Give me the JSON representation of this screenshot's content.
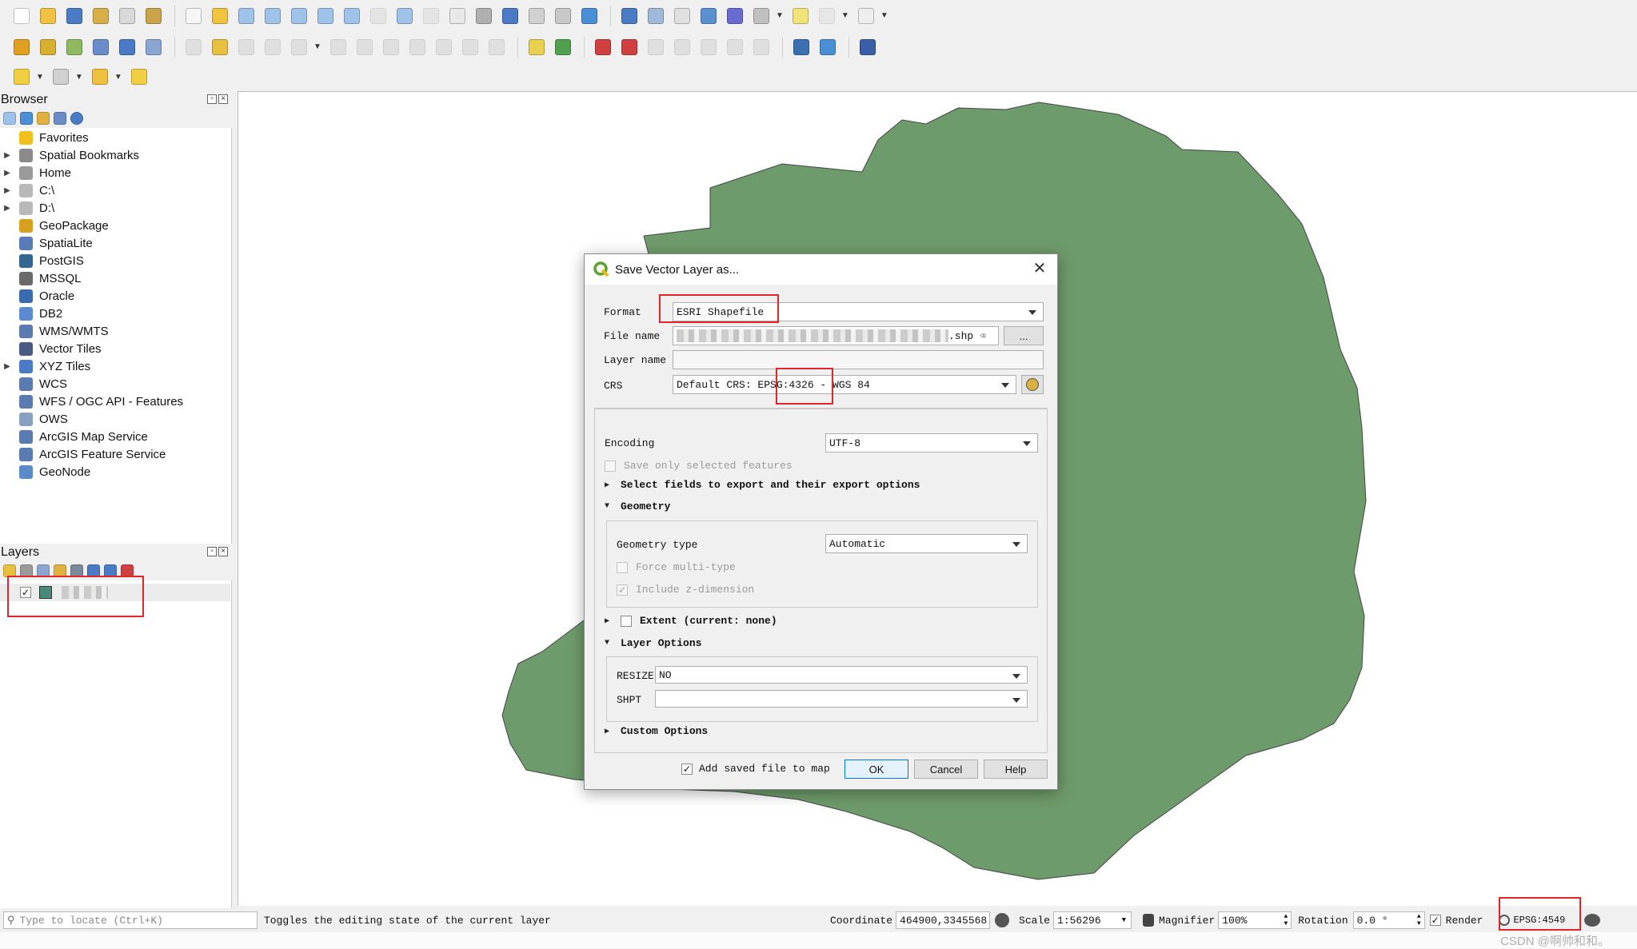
{
  "toolbars": {
    "row1": [
      {
        "name": "new-project-icon",
        "color": "#ffffff"
      },
      {
        "name": "open-project-icon",
        "color": "#f2c244"
      },
      {
        "name": "save-project-icon",
        "color": "#4a7bc4"
      },
      {
        "name": "save-as-icon",
        "color": "#d8b04a"
      },
      {
        "name": "print-layout-icon",
        "color": "#d9d9d9"
      },
      {
        "name": "style-manager-icon",
        "color": "#c9a44a"
      },
      {
        "sep": true
      },
      {
        "name": "pan-map-icon",
        "color": "#f6f6f6"
      },
      {
        "name": "pan-to-selection-icon",
        "color": "#f0c440"
      },
      {
        "name": "zoom-in-icon",
        "color": "#9fc2e8"
      },
      {
        "name": "zoom-out-icon",
        "color": "#9fc2e8"
      },
      {
        "name": "zoom-full-icon",
        "color": "#9fc2e8"
      },
      {
        "name": "zoom-to-selection-icon",
        "color": "#9fc2e8"
      },
      {
        "name": "zoom-to-layer-icon",
        "color": "#9fc2e8"
      },
      {
        "name": "zoom-native-icon",
        "color": "#d0d0d0",
        "dim": true
      },
      {
        "name": "zoom-last-icon",
        "color": "#9fc2e8"
      },
      {
        "name": "zoom-next-icon",
        "color": "#d0d0d0",
        "dim": true
      },
      {
        "name": "new-map-view-icon",
        "color": "#e8e8e8"
      },
      {
        "name": "new-3d-map-icon",
        "color": "#b0b0b0"
      },
      {
        "name": "new-bookmark-icon",
        "color": "#4a7bc4"
      },
      {
        "name": "show-bookmarks-icon",
        "color": "#d0d0d0"
      },
      {
        "name": "temporal-controller-icon",
        "color": "#c8c8c8"
      },
      {
        "name": "refresh-icon",
        "color": "#4a8fd6"
      },
      {
        "sep": true
      },
      {
        "name": "identify-icon",
        "color": "#4a7bc4"
      },
      {
        "name": "attribute-table-icon",
        "color": "#9fb9d9"
      },
      {
        "name": "field-calculator-icon",
        "color": "#e0e0e0"
      },
      {
        "name": "settings-icon",
        "color": "#5a8fd0"
      },
      {
        "name": "statistics-icon",
        "color": "#6a6ad0"
      },
      {
        "name": "measure-icon",
        "color": "#c0c0c0",
        "drop": true
      },
      {
        "name": "map-tips-icon",
        "color": "#f2e27a"
      },
      {
        "name": "selection-options-icon",
        "color": "#d8d8d8",
        "dim": true,
        "drop": true
      },
      {
        "name": "text-annotation-icon",
        "color": "#eeeeee",
        "drop": true
      }
    ],
    "row2": [
      {
        "name": "data-source-manager-icon",
        "color": "#e0a020"
      },
      {
        "name": "new-geopackage-icon",
        "color": "#d8b030"
      },
      {
        "name": "new-shapefile-icon",
        "color": "#90b860"
      },
      {
        "name": "new-spatialite-icon",
        "color": "#6a8cc8"
      },
      {
        "name": "new-temporary-layer-icon",
        "color": "#4a7bc4"
      },
      {
        "name": "new-virtual-layer-icon",
        "color": "#8aa6d0"
      },
      {
        "sep": true
      },
      {
        "name": "current-edits-icon",
        "color": "#c0c0c0",
        "dim": true
      },
      {
        "name": "toggle-editing-icon",
        "color": "#e8c040"
      },
      {
        "name": "save-edits-icon",
        "color": "#c0c0c0",
        "dim": true
      },
      {
        "name": "add-feature-icon",
        "color": "#c0c0c0",
        "dim": true
      },
      {
        "name": "vertex-tool-icon",
        "color": "#c0c0c0",
        "dim": true,
        "drop": true
      },
      {
        "name": "modify-attributes-icon",
        "color": "#c0c0c0",
        "dim": true
      },
      {
        "name": "delete-selected-icon",
        "color": "#c0c0c0",
        "dim": true
      },
      {
        "name": "cut-features-icon",
        "color": "#c0c0c0",
        "dim": true
      },
      {
        "name": "copy-features-icon",
        "color": "#c0c0c0",
        "dim": true
      },
      {
        "name": "paste-features-icon",
        "color": "#c0c0c0",
        "dim": true
      },
      {
        "name": "undo-icon",
        "color": "#c0c0c0",
        "dim": true
      },
      {
        "name": "redo-icon",
        "color": "#c0c0c0",
        "dim": true
      },
      {
        "sep": true
      },
      {
        "name": "label-icon",
        "color": "#e8d050"
      },
      {
        "name": "layer-labeling-icon",
        "color": "#50a050"
      },
      {
        "sep": true
      },
      {
        "name": "pin-labels-icon",
        "color": "#d04040"
      },
      {
        "name": "highlight-pinned-icon",
        "color": "#d04040"
      },
      {
        "name": "move-label-icon",
        "color": "#c0c0c0",
        "dim": true
      },
      {
        "name": "rotate-label-icon",
        "color": "#c0c0c0",
        "dim": true
      },
      {
        "name": "change-label-icon",
        "color": "#c0c0c0",
        "dim": true
      },
      {
        "name": "show-hide-labels-icon",
        "color": "#c0c0c0",
        "dim": true
      },
      {
        "name": "label-props-icon",
        "color": "#c0c0c0",
        "dim": true
      },
      {
        "sep": true
      },
      {
        "name": "python-console-icon",
        "color": "#3a70b0"
      },
      {
        "name": "processing-icon",
        "color": "#4a8fd6"
      },
      {
        "sep": true
      },
      {
        "name": "help-icon",
        "color": "#3a5fa8"
      }
    ],
    "row3": [
      {
        "name": "select-features-icon",
        "color": "#f0d040",
        "drop": true
      },
      {
        "name": "select-by-expression-icon",
        "color": "#d0d0d0",
        "drop": true
      },
      {
        "name": "deselect-all-icon",
        "color": "#f0c040",
        "drop": true
      },
      {
        "name": "select-by-location-icon",
        "color": "#f0d040"
      }
    ]
  },
  "browser": {
    "title": "Browser",
    "items": [
      {
        "label": "Favorites",
        "icon": "star-icon",
        "color": "#f0c020",
        "arrow": ""
      },
      {
        "label": "Spatial Bookmarks",
        "icon": "bookmark-icon",
        "color": "#8a8a8a",
        "arrow": "▶"
      },
      {
        "label": "Home",
        "icon": "home-icon",
        "color": "#9a9a9a",
        "arrow": "▶"
      },
      {
        "label": "C:\\",
        "icon": "drive-icon",
        "color": "#b8b8b8",
        "arrow": "▶"
      },
      {
        "label": "D:\\",
        "icon": "drive-icon",
        "color": "#b8b8b8",
        "arrow": "▶"
      },
      {
        "label": "GeoPackage",
        "icon": "geopackage-icon",
        "color": "#d8a020",
        "arrow": ""
      },
      {
        "label": "SpatiaLite",
        "icon": "spatialite-icon",
        "color": "#5a7ab8",
        "arrow": ""
      },
      {
        "label": "PostGIS",
        "icon": "postgis-icon",
        "color": "#336791",
        "arrow": ""
      },
      {
        "label": "MSSQL",
        "icon": "mssql-icon",
        "color": "#6a6a6a",
        "arrow": ""
      },
      {
        "label": "Oracle",
        "icon": "oracle-icon",
        "color": "#3a6ab0",
        "arrow": ""
      },
      {
        "label": "DB2",
        "icon": "db2-icon",
        "color": "#5a8ad0",
        "arrow": ""
      },
      {
        "label": "WMS/WMTS",
        "icon": "wms-icon",
        "color": "#5a7ab0",
        "arrow": ""
      },
      {
        "label": "Vector Tiles",
        "icon": "vector-tiles-icon",
        "color": "#4a5a80",
        "arrow": ""
      },
      {
        "label": "XYZ Tiles",
        "icon": "xyz-tiles-icon",
        "color": "#4a7bc4",
        "arrow": "▶"
      },
      {
        "label": "WCS",
        "icon": "wcs-icon",
        "color": "#5a7ab0",
        "arrow": ""
      },
      {
        "label": "WFS / OGC API - Features",
        "icon": "wfs-icon",
        "color": "#5a7ab0",
        "arrow": ""
      },
      {
        "label": "OWS",
        "icon": "ows-icon",
        "color": "#8aa0c0",
        "arrow": ""
      },
      {
        "label": "ArcGIS Map Service",
        "icon": "arcgis-map-icon",
        "color": "#5a7ab0",
        "arrow": ""
      },
      {
        "label": "ArcGIS Feature Service",
        "icon": "arcgis-feature-icon",
        "color": "#5a7ab0",
        "arrow": ""
      },
      {
        "label": "GeoNode",
        "icon": "geonode-icon",
        "color": "#5a8ac8",
        "arrow": ""
      }
    ]
  },
  "layers": {
    "title": "Layers",
    "swatch_color": "#4a8a7a",
    "checked": "✓"
  },
  "map": {
    "polygon_fill": "#6e9b6b",
    "polygon_stroke": "#444444"
  },
  "dialog": {
    "title": "Save Vector Layer as...",
    "close": "✕",
    "format_label": "Format",
    "format_value": "ESRI Shapefile",
    "filename_label": "File name",
    "filename_suffix": ".shp",
    "browse_label": "...",
    "layername_label": "Layer name",
    "crs_label": "CRS",
    "crs_value": "Default CRS: EPSG:4326 - WGS 84",
    "encoding_label": "Encoding",
    "encoding_value": "UTF-8",
    "save_selected_label": "Save only selected features",
    "select_fields_label": "Select fields to export and their export options",
    "geometry_label": "Geometry",
    "geometry_type_label": "Geometry type",
    "geometry_type_value": "Automatic",
    "force_multi_label": "Force multi-type",
    "include_z_label": "Include z-dimension",
    "include_z_check": "✓",
    "extent_label": "Extent (current: none)",
    "layer_options_label": "Layer Options",
    "resize_label": "RESIZE",
    "resize_value": "NO",
    "shpt_label": "SHPT",
    "shpt_value": "",
    "custom_options_label": "Custom Options",
    "add_to_map_label": "Add saved file to map",
    "add_to_map_check": "✓",
    "ok_label": "OK",
    "cancel_label": "Cancel",
    "help_label": "Help",
    "arrow_collapsed": "▶",
    "arrow_expanded": "▼"
  },
  "statusbar": {
    "locate_placeholder": "Type to locate (Ctrl+K)",
    "message": "Toggles the editing state of the current layer",
    "coordinate_label": "Coordinate",
    "coordinate_value": "464900,3345568",
    "scale_label": "Scale",
    "scale_value": "1:56296",
    "magnifier_label": "Magnifier",
    "magnifier_value": "100%",
    "rotation_label": "Rotation",
    "rotation_value": "0.0 °",
    "render_label": "Render",
    "render_check": "✓",
    "crs_value": "EPSG:4549",
    "watermark": "CSDN @啊帅和和。"
  },
  "colors": {
    "annotation_red": "#e0262c"
  }
}
